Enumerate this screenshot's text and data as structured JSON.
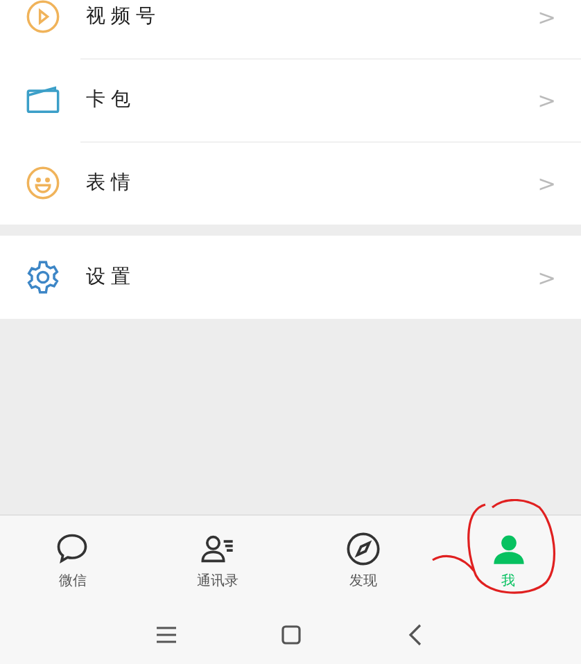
{
  "menu_groups": [
    {
      "items": [
        {
          "label": "视频号",
          "chevron": ">"
        },
        {
          "label": "卡包",
          "chevron": ">"
        },
        {
          "label": "表情",
          "chevron": ">"
        }
      ]
    },
    {
      "items": [
        {
          "label": "设置",
          "chevron": ">"
        }
      ]
    }
  ],
  "tabs": [
    {
      "label": "微信",
      "selected": false
    },
    {
      "label": "通讯录",
      "selected": false
    },
    {
      "label": "发现",
      "selected": false
    },
    {
      "label": "我",
      "selected": true
    }
  ],
  "annotation": {
    "kind": "circle"
  }
}
